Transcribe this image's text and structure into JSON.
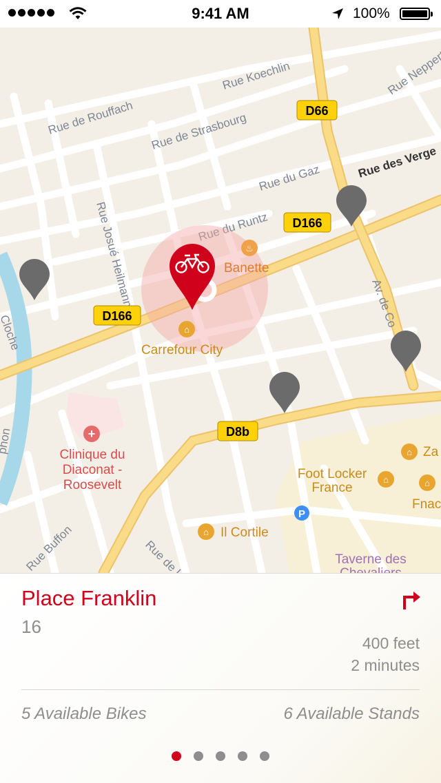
{
  "status_bar": {
    "time": "9:41 AM",
    "battery": "100%"
  },
  "map": {
    "streets": {
      "rouffach": "Rue de Rouffach",
      "koechlin": "Rue Koechlin",
      "strasbourg": "Rue de Strasbourg",
      "gaz": "Rue du Gaz",
      "runtz": "Rue du Runtz",
      "vergers": "Rue des Verge",
      "neppert": "Rue Neppert",
      "heilmann": "Rue Josué Heilmann",
      "colmar": "Av. de Co",
      "buffon": "Rue Buffon",
      "rue_de": "Rue de l",
      "cloche": "Cloche",
      "phon": "phon"
    },
    "road_badges": {
      "d66": "D66",
      "d166_a": "D166",
      "d166_b": "D166",
      "d8b": "D8b"
    },
    "pois": {
      "banette": "Banette",
      "carrefour": "Carrefour City",
      "clinique_1": "Clinique du",
      "clinique_2": "Diaconat -",
      "clinique_3": "Roosevelt",
      "footlocker_1": "Foot Locker",
      "footlocker_2": "France",
      "ilcortile": "Il Cortile",
      "taverne_1": "Taverne des",
      "taverne_2": "Chevaliers",
      "za": "Za",
      "fnac": "Fnac"
    },
    "colors": {
      "accent": "#d0021b",
      "pin_gray": "#6b6b6b",
      "road_major": "#f9db88",
      "badge": "#ffd10a",
      "water": "#a6d8ea"
    }
  },
  "station": {
    "name": "Place Franklin",
    "number": "16",
    "distance": "400 feet",
    "duration": "2 minutes",
    "available_bikes": "5 Available Bikes",
    "available_stands": "6 Available Stands"
  },
  "pager": {
    "count": 5,
    "active": 1
  }
}
